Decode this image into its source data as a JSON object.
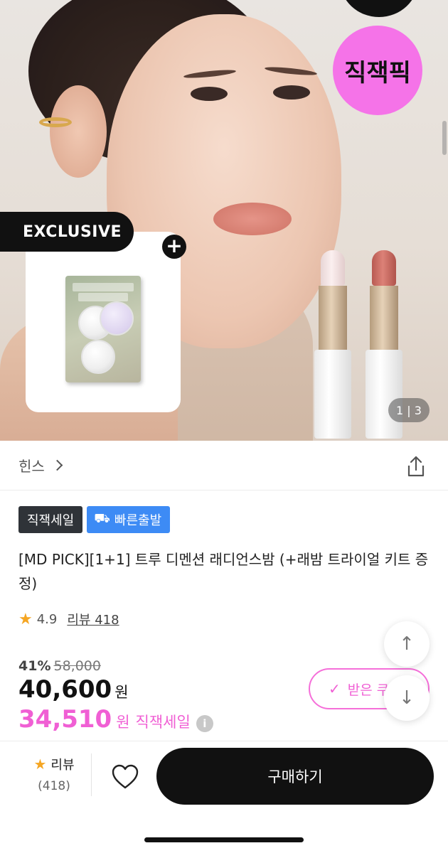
{
  "hero": {
    "badge_text": "직잭픽",
    "exclusive_label": "EXCLUSIVE",
    "plus_icon": "+",
    "pager": "1 | 3"
  },
  "brand": {
    "name": "힌스"
  },
  "tags": {
    "sale": "직잭세일",
    "fast": "빠른출발",
    "fast_icon": "⛟"
  },
  "product": {
    "title": "[MD PICK][1+1] 트루 디멘션 래디언스밤 (+래밤 트라이얼 키트 증정)",
    "rating_star": "★",
    "rating": "4.9",
    "reviews_link": "리뷰 418"
  },
  "price": {
    "discount": "41%",
    "original": "58,000",
    "current": "40,600",
    "currency": "원",
    "sale_price": "34,510",
    "sale_label": "직잭세일",
    "info_icon": "i"
  },
  "coupon": {
    "check_icon": "✓",
    "label": "받은 쿠"
  },
  "float": {
    "up_icon": "↑",
    "down_icon": "↓"
  },
  "bottom_bar": {
    "review_star": "★",
    "review_label": "리뷰",
    "review_count": "(418)",
    "buy_label": "구매하기"
  },
  "colors": {
    "accent_pink": "#f05fd4",
    "badge_pink": "#f573e8",
    "tag_blue": "#3d8bf5",
    "tag_dark": "#2f3338",
    "star": "#f5a623"
  }
}
